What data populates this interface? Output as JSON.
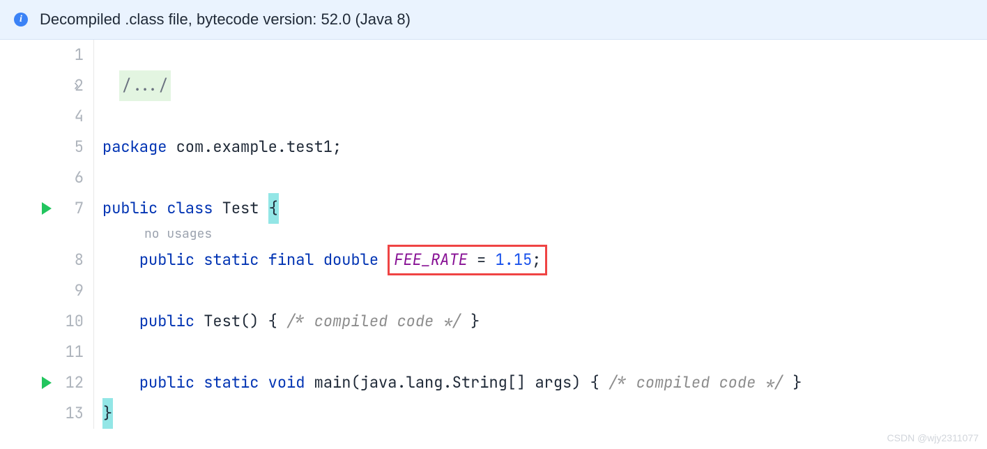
{
  "banner": {
    "text": "Decompiled .class file, bytecode version: 52.0 (Java 8)"
  },
  "lines": {
    "l1": "1",
    "l2": "2",
    "l4": "4",
    "l5": "5",
    "l6": "6",
    "l7": "7",
    "l8": "8",
    "l9": "9",
    "l10": "10",
    "l11": "11",
    "l12": "12",
    "l13": "13"
  },
  "code": {
    "folded": "/.../",
    "kw_package": "package",
    "pkg_name": " com.example.test1;",
    "kw_public": "public",
    "kw_class": "class",
    "cls_name": "Test",
    "brace_open": "{",
    "brace_close": "}",
    "usage_hint": "no usages",
    "kw_static": "static",
    "kw_final": "final",
    "kw_double": "double",
    "field_name": "FEE_RATE",
    "eq": " = ",
    "field_val": "1.15",
    "semi": ";",
    "ctor": "Test",
    "parens": "()",
    "space_brace": " { ",
    "compiled": "/* compiled code */",
    "close_brace_sp": " }",
    "kw_void": "void",
    "main_name": "main",
    "main_args": "(java.lang.String[] args)"
  },
  "watermark": "CSDN @wjy2311077"
}
